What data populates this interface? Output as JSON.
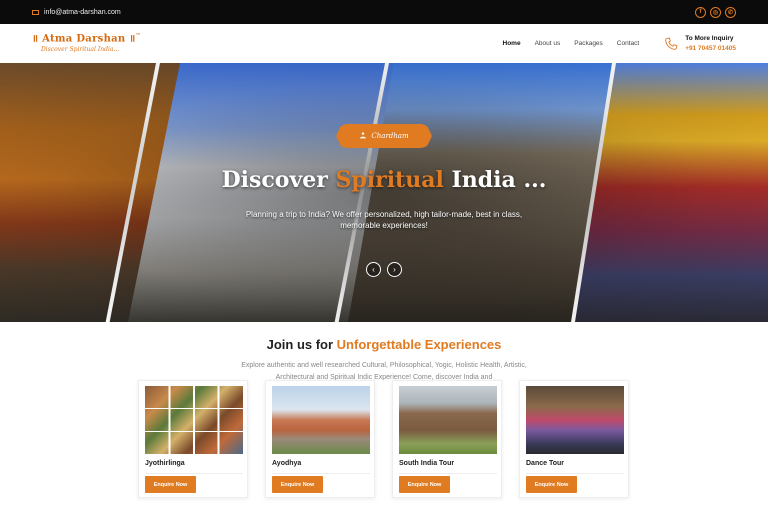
{
  "topbar": {
    "email": "info@atma-darshan.com",
    "socials": [
      {
        "icon": "facebook-icon",
        "glyph": "f"
      },
      {
        "icon": "instagram-icon",
        "glyph": "◎"
      },
      {
        "icon": "whatsapp-icon",
        "glyph": "✆"
      }
    ]
  },
  "brand": {
    "name": "॥ Atma Darshan ॥",
    "trademark": "™",
    "tagline": "Discover Spiritual India..."
  },
  "nav": {
    "items": [
      {
        "label": "Home",
        "active": true
      },
      {
        "label": "About us",
        "active": false
      },
      {
        "label": "Packages",
        "active": false
      },
      {
        "label": "Contact",
        "active": false
      }
    ],
    "inquiry_label": "To More Inquiry",
    "inquiry_phone": "+91 70457 01405"
  },
  "hero": {
    "badge": "Chardham",
    "title_part1": "Discover ",
    "title_highlight": "Spiritual",
    "title_part2": " India ...",
    "subtitle": "Planning a trip to India? We offer personalized, high tailor-made, best in class, memorable experiences!",
    "prev_arrow": "‹",
    "next_arrow": "›"
  },
  "section": {
    "title_part1": "Join us for ",
    "title_highlight": "Unforgettable Experiences",
    "description": "Explore authentic and well researched Cultural, Philosophical, Yogic, Holistic Health, Artistic, Architectural and Spiritual Indic Experience! Come, discover India and"
  },
  "cards": [
    {
      "title": "Jyothirlinga",
      "button": "Enquire Now"
    },
    {
      "title": "Ayodhya",
      "button": "Enquire Now"
    },
    {
      "title": "South India Tour",
      "button": "Enquire Now"
    },
    {
      "title": "Dance Tour",
      "button": "Enquire Now"
    }
  ],
  "colors": {
    "accent": "#e07b22",
    "topbar": "#0b0b0b"
  }
}
